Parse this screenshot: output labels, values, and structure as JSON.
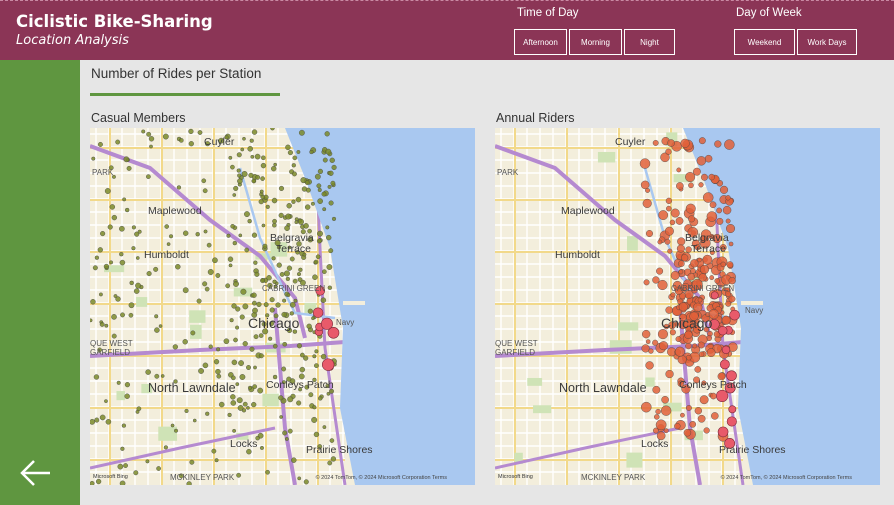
{
  "header": {
    "title": "Ciclistic Bike-Sharing",
    "subtitle": "Location Analysis"
  },
  "slicers": {
    "time_of_day": {
      "title": "Time of Day",
      "options": [
        "Afternoon",
        "Morning",
        "Night"
      ]
    },
    "day_of_week": {
      "title": "Day of Week",
      "options": [
        "Weekend",
        "Work Days"
      ]
    }
  },
  "section": {
    "title": "Number of Rides per Station"
  },
  "panels": [
    {
      "label": "Casual Members"
    },
    {
      "label": "Annual Riders"
    }
  ],
  "map_labels": {
    "cuyler": "Cuyler",
    "park": "PARK",
    "maplewood": "Maplewood",
    "belgravia": "Belgravia",
    "terrace": "Terrace",
    "humboldt": "Humboldt",
    "chicago": "Chicago",
    "cabrini": "CABRINI GREEN",
    "navy_pier": "Navy",
    "que_west": "QUE WEST",
    "garfield": "GARFIELD",
    "north_lawndale": "North Lawndale",
    "conleys_patch": "Conleys Patch",
    "locks": "Locks",
    "prairie_shores": "Prairie Shores",
    "mckinley_park": "MCKINLEY PARK",
    "bing": "Microsoft Bing",
    "attribution": "© 2024 TomTom, © 2024 Microsoft Corporation  Terms"
  },
  "colors": {
    "header": "#8b3556",
    "sidebar": "#5f9640",
    "accent_line": "#5f9640",
    "water": "#a9c8f0",
    "casual_dot": "#7a8a2a",
    "annual_dot": "#e0603a"
  },
  "icons": {
    "back": "arrow-left-icon"
  }
}
